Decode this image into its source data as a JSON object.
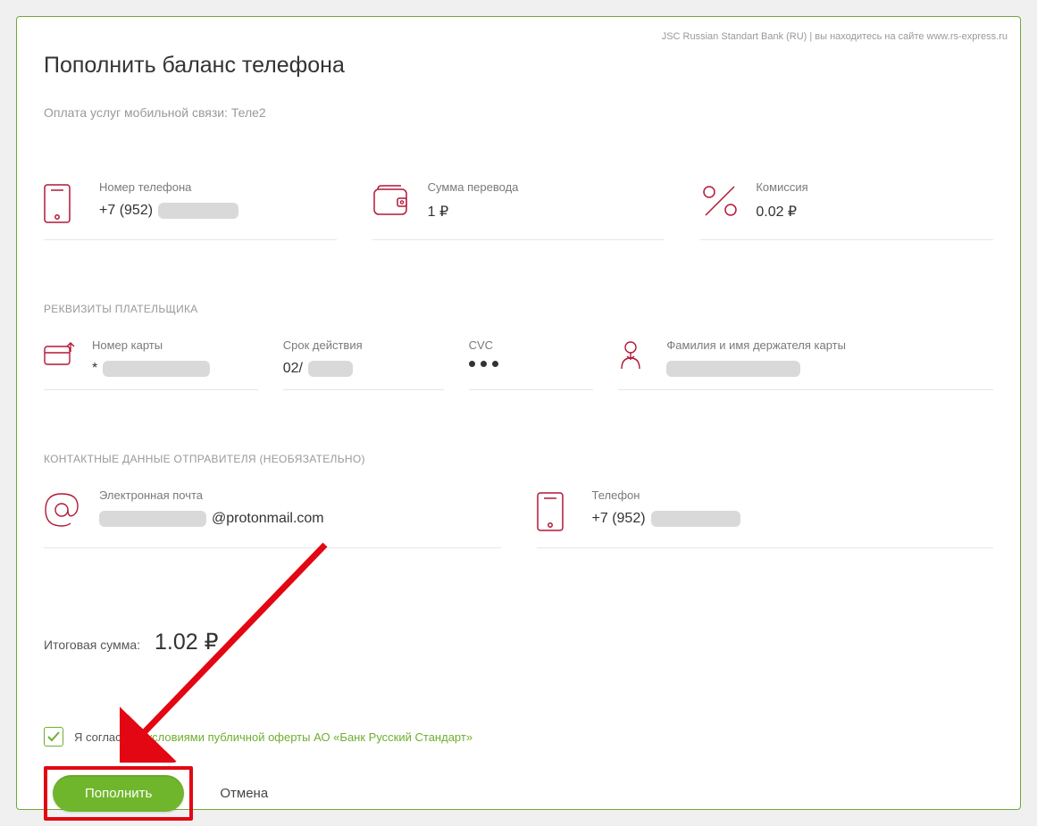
{
  "header": {
    "site_note": "JSC Russian Standart Bank (RU) | вы находитесь на сайте www.rs-express.ru",
    "title": "Пополнить баланс телефона",
    "subtitle": "Оплата услуг мобильной связи: Теле2"
  },
  "transfer": {
    "phone_label": "Номер телефона",
    "phone_prefix": "+7 (952)",
    "amount_label": "Сумма перевода",
    "amount_value": "1 ₽",
    "fee_label": "Комиссия",
    "fee_value": "0.02 ₽"
  },
  "payer": {
    "section_title": "РЕКВИЗИТЫ ПЛАТЕЛЬЩИКА",
    "card_label": "Номер карты",
    "card_prefix": "*",
    "exp_label": "Срок действия",
    "exp_prefix": "02/",
    "cvc_label": "CVC",
    "holder_label": "Фамилия и имя держателя карты"
  },
  "contact": {
    "section_title": "КОНТАКТНЫЕ ДАННЫЕ ОТПРАВИТЕЛЯ (НЕОБЯЗАТЕЛЬНО)",
    "email_label": "Электронная почта",
    "email_suffix": "@protonmail.com",
    "phone_label": "Телефон",
    "phone_prefix": "+7 (952)"
  },
  "total": {
    "label": "Итоговая сумма:",
    "value": "1.02 ₽"
  },
  "consent": {
    "prefix": "Я согласен с ",
    "link": "условиями публичной оферты АО «Банк Русский Стандарт»"
  },
  "actions": {
    "submit": "Пополнить",
    "cancel": "Отмена"
  }
}
